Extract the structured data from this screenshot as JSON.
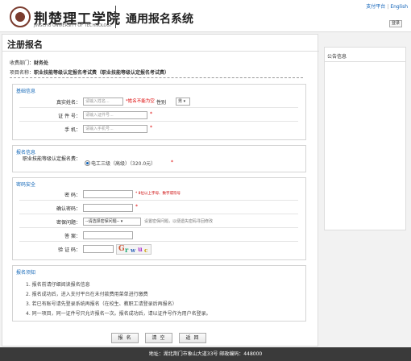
{
  "header": {
    "school_cn": "荆楚理工学院",
    "school_en": "JINGCHU UNIVERSITY OF TECHNOLOGY",
    "system_title": "通用报名系统",
    "link_pay": "支付平台",
    "link_sep": "|",
    "link_english": "English",
    "login_label": "登录"
  },
  "page": {
    "title": "注册报名",
    "dept_label": "收费部门：",
    "dept_value": "财务处",
    "project_label": "项目名称：",
    "project_value": "职业技能等级认定报名考试费（职业技能等级认定报名考试费）"
  },
  "basic": {
    "title": "基础信息",
    "name_label": "真实姓名：",
    "name_placeholder": "请输入姓名...",
    "name_req": "*姓名不能为空",
    "gender_label": "性别",
    "gender_value": "男",
    "id_label": "证 件 号：",
    "id_placeholder": "请输入证件号...",
    "id_req": "*",
    "phone_label": "手 机：",
    "phone_placeholder": "请输入手机号...",
    "phone_req": "*"
  },
  "signup": {
    "title": "报名信息",
    "level_label": "职业技能等级认定报名费：",
    "option_label": "电工三级（高级）（320.0元）",
    "req": "*"
  },
  "security": {
    "title": "密码安全",
    "pwd_label": "密 码：",
    "pwd_hint": "* 8位以上字母、数字或符号",
    "confirm_label": "确认密码：",
    "confirm_req": "*",
    "question_label": "密保问题：",
    "question_value": "--请选择密保问题--",
    "question_hint": "设置密保问题，以便遗失密码寻回修改",
    "answer_label": "答 案：",
    "captcha_label": "验 证 码："
  },
  "notice": {
    "title": "报名须知",
    "items": [
      "1. 报名前请仔细阅读报名信息",
      "2. 报名成功后，进入支付平台在未付款费用菜单进行缴费",
      "3. 若已有账号请先登录系统再报名（在校生、教职工请登录后再报名）",
      "4. 同一项目，同一证件号只允许报名一次。报名成功后，请以证件号作为用户名登录。"
    ]
  },
  "buttons": {
    "submit": "报 名",
    "reset": "清 空",
    "back": "返 回"
  },
  "sidebar": {
    "title": "公告信息"
  },
  "footer": {
    "address": "地址：湖北荆门市象山大道33号 邮政编码：448000"
  }
}
